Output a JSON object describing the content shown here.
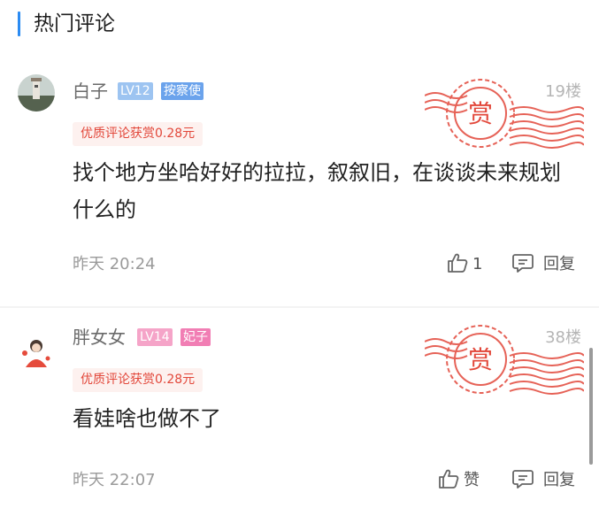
{
  "header": {
    "title": "热门评论"
  },
  "reward_stamp": {
    "char": "赏",
    "color": "#e2473a"
  },
  "comments": [
    {
      "username": "白子",
      "level": "LV12",
      "role": "按察使",
      "floor": "19楼",
      "reward": "优质评论获赏0.28元",
      "content": "找个地方坐哈好好的拉拉，叙叙旧，在谈谈未来规划什么的",
      "time": "昨天 20:24",
      "like_label": "1",
      "reply_label": "回复"
    },
    {
      "username": "胖女女",
      "level": "LV14",
      "role": "妃子",
      "floor": "38楼",
      "reward": "优质评论获赏0.28元",
      "content": "看娃啥也做不了",
      "time": "昨天 22:07",
      "like_label": "赞",
      "reply_label": "回复"
    }
  ]
}
